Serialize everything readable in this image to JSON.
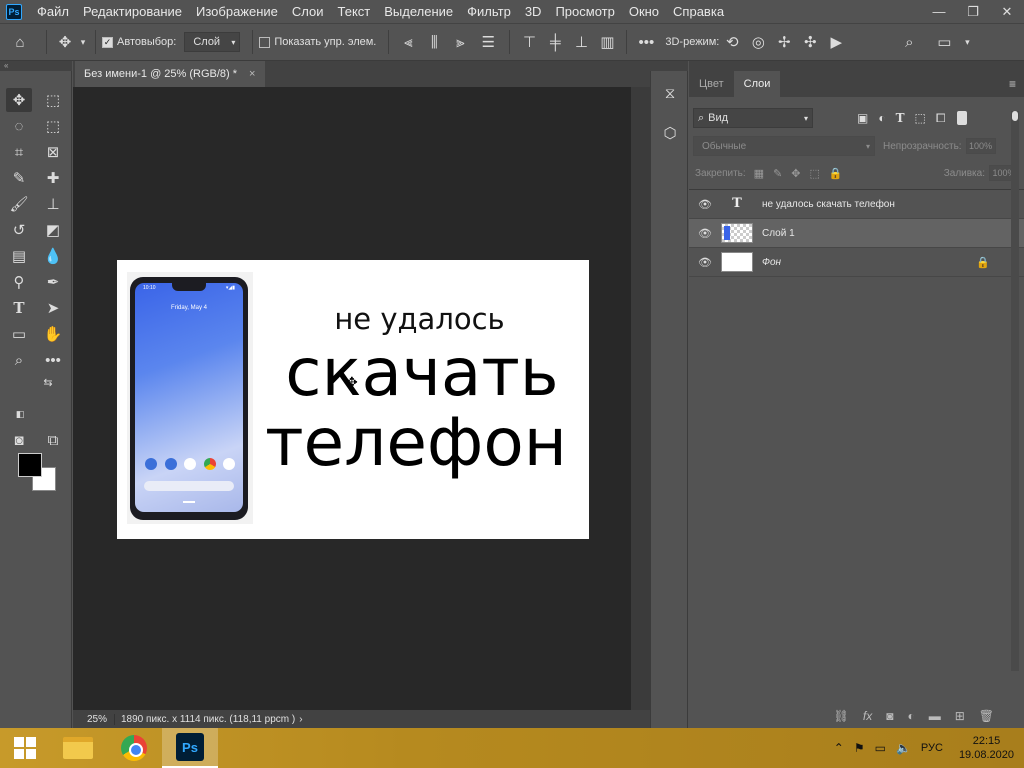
{
  "menubar": {
    "logo": "Ps",
    "items": [
      "Файл",
      "Редактирование",
      "Изображение",
      "Слои",
      "Текст",
      "Выделение",
      "Фильтр",
      "3D",
      "Просмотр",
      "Окно",
      "Справка"
    ],
    "win_min": "—",
    "win_restore": "❐",
    "win_close": "✕"
  },
  "options": {
    "autoselect_label": "Автовыбор:",
    "autoselect_value": "Слой",
    "show_transform_label": "Показать упр. элем.",
    "mode_3d_label": "3D-режим:"
  },
  "document": {
    "tab_title": "Без имени-1 @ 25% (RGB/8) *",
    "tab_close": "×",
    "zoom": "25%",
    "info": "1890 пикс. x 1114 пикс. (118,11 ppcm )",
    "phone": {
      "time": "10:10",
      "icons": "▾◢▮",
      "date": "Friday, May 4"
    },
    "text_line1": "не удалось",
    "text_line2": "скачать",
    "text_line3": "телефон"
  },
  "panel": {
    "tabs": [
      "Цвет",
      "Слои"
    ],
    "active_tab": "Слои",
    "filter_label": "Вид",
    "blend_mode": "Обычные",
    "opacity_label": "Непрозрачность:",
    "opacity_value": "100%",
    "lock_label": "Закрепить:",
    "fill_label": "Заливка:",
    "fill_value": "100%",
    "layers": [
      {
        "name": "не удалось скачать телефон",
        "type": "text"
      },
      {
        "name": "Слой 1",
        "type": "image"
      },
      {
        "name": "Фон",
        "type": "background"
      }
    ]
  },
  "taskbar": {
    "ps_label": "Ps",
    "lang": "РУС",
    "time": "22:15",
    "date": "19.08.2020"
  },
  "colors": {
    "ui_bg": "#535353",
    "workspace": "#282828",
    "taskbar": "#b68a1f",
    "ps_blue": "#31a8ff"
  }
}
